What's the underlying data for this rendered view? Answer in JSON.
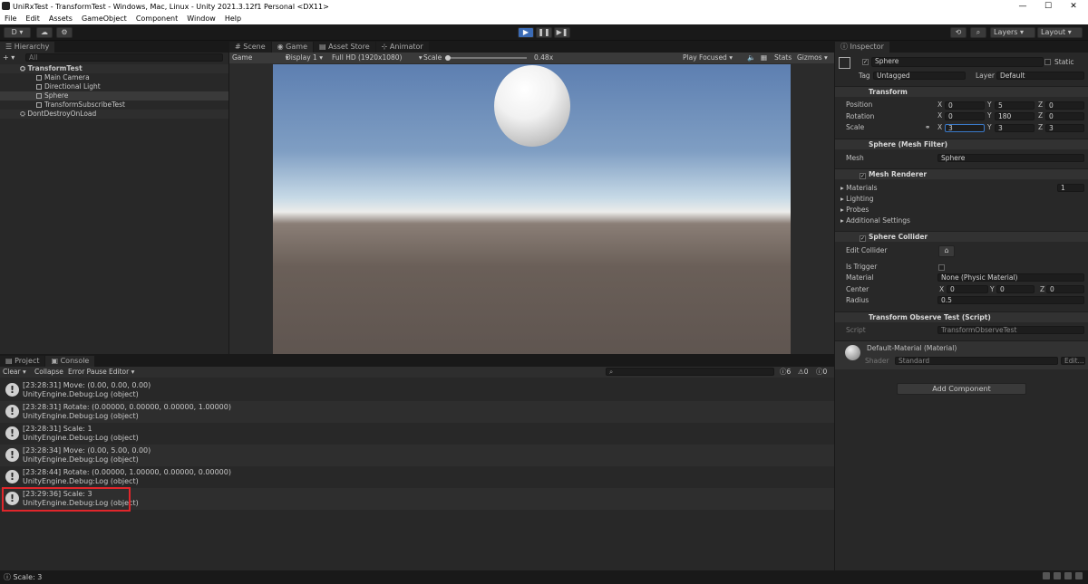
{
  "window": {
    "title": "UniRxTest - TransformTest - Windows, Mac, Linux - Unity 2021.3.12f1 Personal <DX11>",
    "min": "—",
    "max": "☐",
    "close": "✕"
  },
  "menu": [
    "File",
    "Edit",
    "Assets",
    "GameObject",
    "Component",
    "Window",
    "Help"
  ],
  "toolbar": {
    "account": "D ▾",
    "layers": "Layers",
    "layout": "Layout",
    "play": "▶",
    "pause": "❚❚",
    "step": "▶❚"
  },
  "hierarchy": {
    "tab": "Hierarchy",
    "search_placeholder": "All",
    "add": "+ ▾",
    "scene": "TransformTest",
    "items": [
      "Main Camera",
      "Directional Light",
      "Sphere",
      "TransformSubscribeTest"
    ],
    "dontdestroy": "DontDestroyOnLoad"
  },
  "views": {
    "tabs": [
      "Scene",
      "Game",
      "Asset Store",
      "Animator"
    ],
    "game_label": "Game",
    "display": "Display 1",
    "resolution": "Full HD (1920x1080)",
    "scale_label": "Scale",
    "scale_value": "0.48x",
    "play_focused": "Play Focused",
    "stats": "Stats",
    "gizmos": "Gizmos"
  },
  "console": {
    "tabs": [
      "Project",
      "Console"
    ],
    "clear": "Clear",
    "collapse": "Collapse",
    "error_pause": "Error Pause",
    "editor": "Editor",
    "count_info": "6",
    "count_warn": "0",
    "count_err": "0",
    "logs": [
      {
        "line1": "[23:28:31] Move: (0.00, 0.00, 0.00)",
        "line2": "UnityEngine.Debug:Log (object)"
      },
      {
        "line1": "[23:28:31] Rotate: (0.00000, 0.00000, 0.00000, 1.00000)",
        "line2": "UnityEngine.Debug:Log (object)"
      },
      {
        "line1": "[23:28:31] Scale: 1",
        "line2": "UnityEngine.Debug:Log (object)"
      },
      {
        "line1": "[23:28:34] Move: (0.00, 5.00, 0.00)",
        "line2": "UnityEngine.Debug:Log (object)"
      },
      {
        "line1": "[23:28:44] Rotate: (0.00000, 1.00000, 0.00000, 0.00000)",
        "line2": "UnityEngine.Debug:Log (object)"
      },
      {
        "line1": "[23:29:36] Scale: 3",
        "line2": "UnityEngine.Debug:Log (object)"
      }
    ]
  },
  "inspector": {
    "tab": "Inspector",
    "object_name": "Sphere",
    "static": "Static",
    "tag_label": "Tag",
    "tag": "Untagged",
    "layer_label": "Layer",
    "layer": "Default",
    "transform": {
      "title": "Transform",
      "position": "Position",
      "rotation": "Rotation",
      "scale": "Scale",
      "pos": [
        "0",
        "5",
        "0"
      ],
      "rot": [
        "0",
        "180",
        "0"
      ],
      "scl": [
        "3",
        "3",
        "3"
      ]
    },
    "mesh_filter": {
      "title": "Sphere (Mesh Filter)",
      "mesh_label": "Mesh",
      "mesh": "Sphere"
    },
    "mesh_renderer": {
      "title": "Mesh Renderer",
      "materials": "Materials",
      "materials_count": "1",
      "lighting": "Lighting",
      "probes": "Probes",
      "additional": "Additional Settings"
    },
    "collider": {
      "title": "Sphere Collider",
      "edit": "Edit Collider",
      "is_trigger": "Is Trigger",
      "material_label": "Material",
      "material": "None (Physic Material)",
      "center": "Center",
      "center_v": [
        "0",
        "0",
        "0"
      ],
      "radius_label": "Radius",
      "radius": "0.5"
    },
    "script": {
      "title": "Transform Observe Test (Script)",
      "script_label": "Script",
      "script": "TransformObserveTest"
    },
    "material": {
      "name": "Default-Material (Material)",
      "shader_label": "Shader",
      "shader": "Standard",
      "edit": "Edit..."
    },
    "add_component": "Add Component"
  },
  "status": {
    "text": "Scale: 3"
  }
}
